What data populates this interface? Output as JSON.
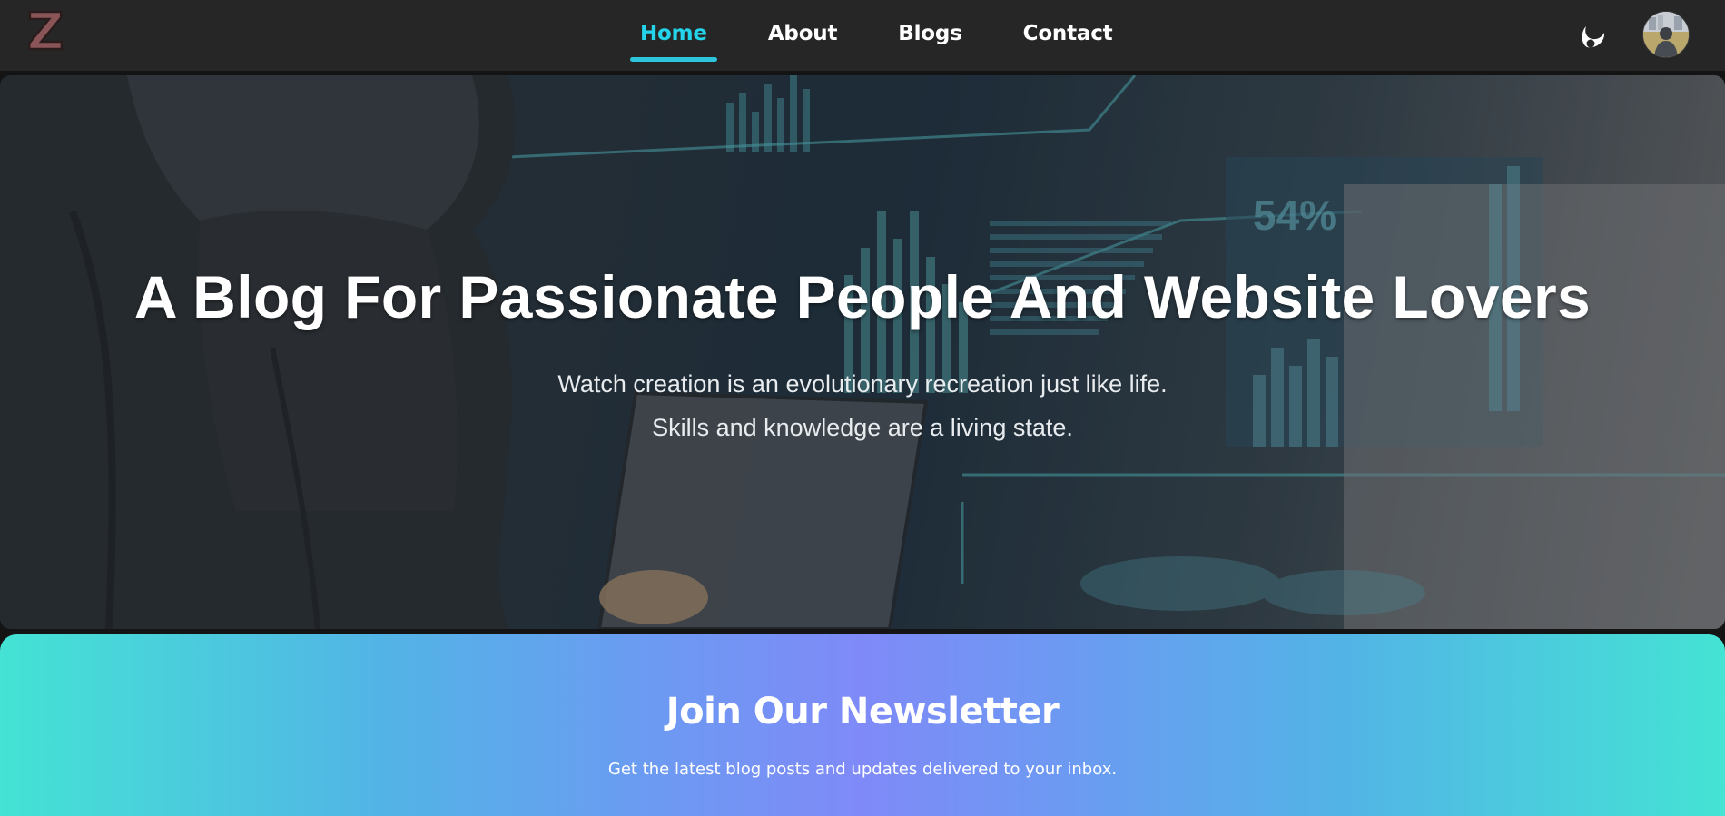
{
  "navbar": {
    "logo_letter": "Z",
    "links": [
      {
        "label": "Home",
        "active": true
      },
      {
        "label": "About",
        "active": false
      },
      {
        "label": "Blogs",
        "active": false
      },
      {
        "label": "Contact",
        "active": false
      }
    ],
    "theme_icon": "moon-icon",
    "avatar_icon": "user-avatar"
  },
  "hero": {
    "title": "A Blog For Passionate People And Website Lovers",
    "subtitle_line1": "Watch creation is an evolutionary recreation just like life.",
    "subtitle_line2": "Skills and knowledge are a living state.",
    "background_stat": "54%"
  },
  "newsletter": {
    "title": "Join Our Newsletter",
    "description": "Get the latest blog posts and updates delivered to your inbox."
  },
  "colors": {
    "active_link": "#24d4ea",
    "navbar_bg": "#262626",
    "newsletter_gradient_start": "#44e3d4",
    "newsletter_gradient_mid": "#7f8af8"
  }
}
